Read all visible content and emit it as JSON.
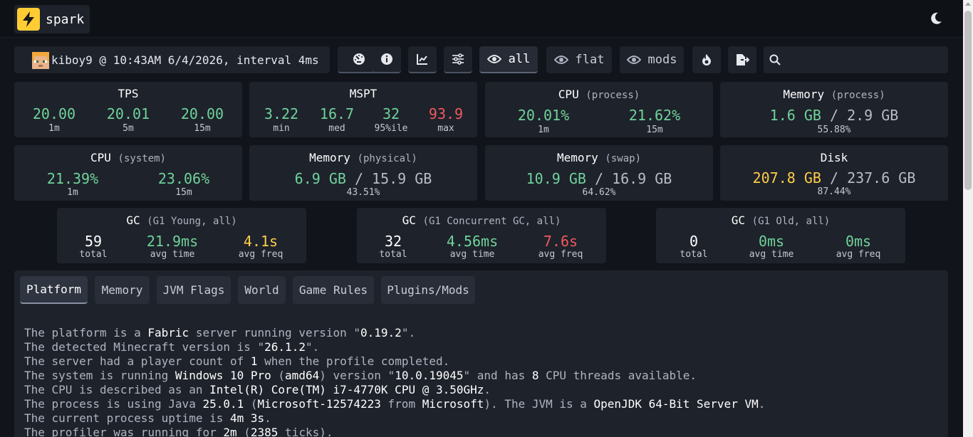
{
  "app": {
    "name": "spark",
    "accent": "#ffcd33"
  },
  "header": {
    "theme_toggle_icon": "moon-icon"
  },
  "toolbar": {
    "meta": "kiboy9 @ 10:43AM 6/4/2026, interval 4ms",
    "buttons": [
      {
        "icon": "dashboard-icon"
      },
      {
        "icon": "info-icon"
      },
      {
        "icon": "graph-icon"
      },
      {
        "icon": "sliders-icon"
      },
      {
        "icon": "eye-icon",
        "label": "all"
      },
      {
        "icon": "eye-icon",
        "label": "flat"
      },
      {
        "icon": "eye-icon",
        "label": "mods"
      },
      {
        "icon": "flame-icon"
      },
      {
        "icon": "export-icon"
      }
    ],
    "search_placeholder": ""
  },
  "stats": {
    "tps": {
      "title": "TPS",
      "values": [
        "20.00",
        "20.01",
        "20.00"
      ],
      "labels": [
        "1m",
        "5m",
        "15m"
      ]
    },
    "mspt": {
      "title": "MSPT",
      "values": [
        "3.22",
        "16.7",
        "32",
        "93.9"
      ],
      "labels": [
        "min",
        "med",
        "95%ile",
        "max"
      ]
    },
    "cpu_process": {
      "title": "CPU",
      "sub": "(process)",
      "values": [
        "20.01%",
        "21.62%"
      ],
      "labels": [
        "1m",
        "15m"
      ]
    },
    "memory_process": {
      "title": "Memory",
      "sub": "(process)",
      "used": "1.6 GB",
      "sep": "/",
      "total": "2.9 GB",
      "percent": "55.88%"
    },
    "cpu_system": {
      "title": "CPU",
      "sub": "(system)",
      "values": [
        "21.39%",
        "23.06%"
      ],
      "labels": [
        "1m",
        "15m"
      ]
    },
    "memory_physical": {
      "title": "Memory",
      "sub": "(physical)",
      "used": "6.9 GB",
      "sep": "/",
      "total": "15.9 GB",
      "percent": "43.51%"
    },
    "memory_swap": {
      "title": "Memory",
      "sub": "(swap)",
      "used": "10.9 GB",
      "sep": "/",
      "total": "16.9 GB",
      "percent": "64.62%"
    },
    "disk": {
      "title": "Disk",
      "used": "207.8 GB",
      "sep": "/",
      "total": "237.6 GB",
      "percent": "87.44%"
    }
  },
  "gc": [
    {
      "title": "GC",
      "sub": "(G1 Young, all)",
      "total": "59",
      "avg_time": "21.9ms",
      "avg_freq": "4.1s",
      "labels": [
        "total",
        "avg time",
        "avg freq"
      ]
    },
    {
      "title": "GC",
      "sub": "(G1 Concurrent GC, all)",
      "total": "32",
      "avg_time": "4.56ms",
      "avg_freq": "7.6s",
      "labels": [
        "total",
        "avg time",
        "avg freq"
      ]
    },
    {
      "title": "GC",
      "sub": "(G1 Old, all)",
      "total": "0",
      "avg_time": "0ms",
      "avg_freq": "0ms",
      "labels": [
        "total",
        "avg time",
        "avg freq"
      ]
    }
  ],
  "tabs": [
    "Platform",
    "Memory",
    "JVM Flags",
    "World",
    "Game Rules",
    "Plugins/Mods"
  ],
  "platform": {
    "lines": [
      [
        "The platform is a ",
        "Fabric",
        " server running version \"",
        "0.19.2",
        "\"."
      ],
      [
        "The detected Minecraft version is \"",
        "26.1.2",
        "\"."
      ],
      [
        "The server had a player count of ",
        "1",
        " when the profile completed."
      ],
      [
        "The system is running ",
        "Windows 10 Pro",
        " (",
        "amd64",
        ") version \"",
        "10.0.19045",
        "\" and has ",
        "8",
        " CPU threads available."
      ],
      [
        "The CPU is described as an ",
        "Intel(R) Core(TM) i7-4770K CPU @ 3.50GHz",
        "."
      ],
      [
        "The process is using Java ",
        "25.0.1",
        " (",
        "Microsoft-12574223",
        " from ",
        "Microsoft",
        "). The JVM is a ",
        "OpenJDK 64-Bit Server VM",
        "."
      ],
      [
        "The current process uptime is ",
        "4m 3s",
        "."
      ],
      [
        "The profiler was running for ",
        "2m",
        " (",
        "2385",
        " ticks)."
      ]
    ]
  }
}
